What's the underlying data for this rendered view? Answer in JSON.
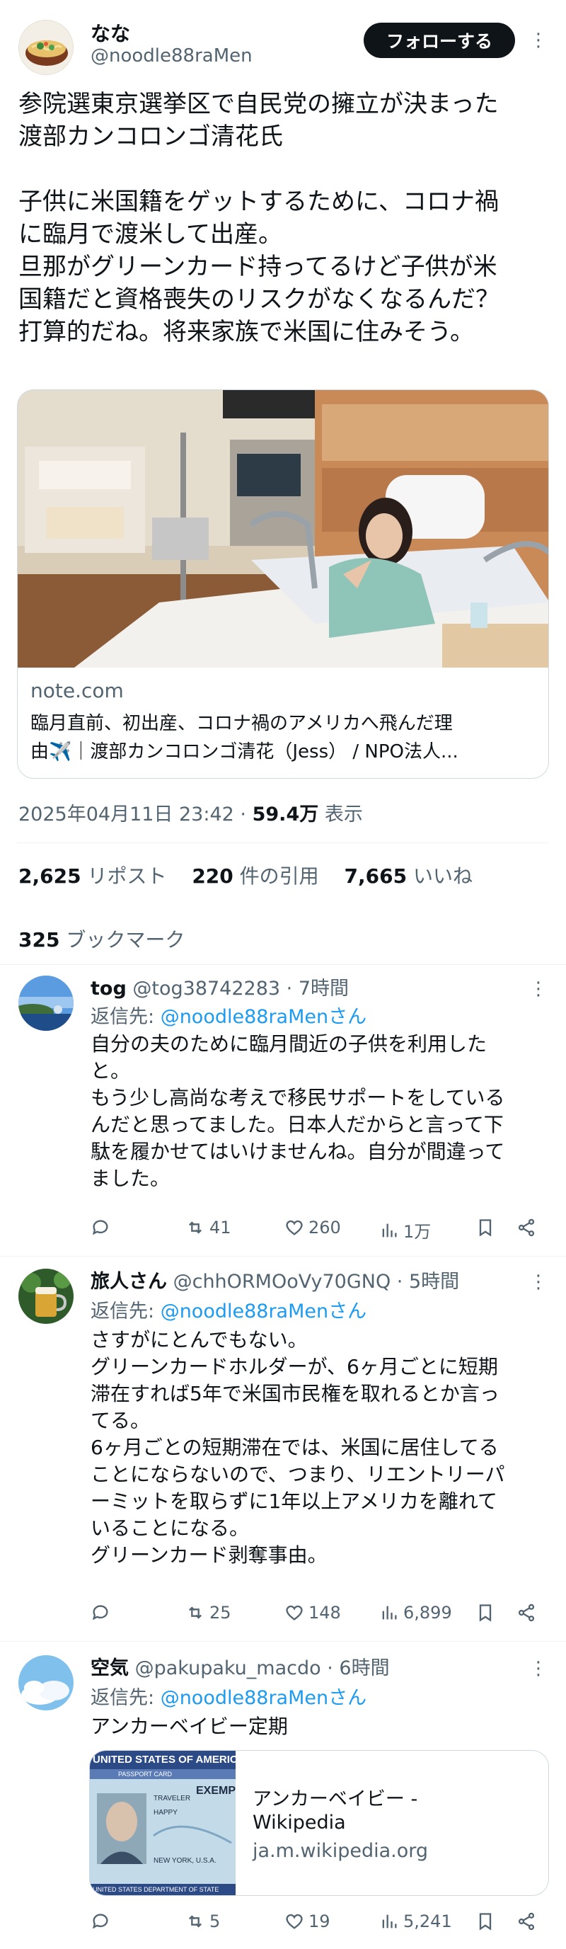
{
  "post": {
    "display_name": "なな",
    "handle": "@noodle88raMen",
    "follow_label": "フォローする",
    "text": "参院選東京選挙区で自民党の擁立が決まった\n渡部カンコロンゴ清花氏\n\n子供に米国籍をゲットするために、コロナ禍\nに臨月で渡米して出産。\n旦那がグリーンカード持ってるけど子供が米\n国籍だと資格喪失のリスクがなくなるんだ？\n打算的だね。将来家族で米国に住みそう。",
    "card": {
      "domain": "note.com",
      "title_line1": "臨月直前、初出産、コロナ禍のアメリカへ飛んだ理",
      "title_line2": "由✈️｜渡部カンコロンゴ清花（Jess） / NPO法人..."
    },
    "timestamp": "2025年04月11日 23:42",
    "dot": "·",
    "views_count": "59.4万",
    "views_label": "表示",
    "reposts_count": "2,625",
    "reposts_label": "リポスト",
    "quotes_count": "220",
    "quotes_label": "件の引用",
    "likes_count": "7,665",
    "likes_label": "いいね",
    "bookmarks_count": "325",
    "bookmarks_label": "ブックマーク"
  },
  "replies": [
    {
      "display_name": "tog",
      "handle": "@tog38742283",
      "time": "· 7時間",
      "reply_to_prefix": "返信先: ",
      "reply_to_handle": "@noodle88raMenさん",
      "text": "自分の夫のために臨月間近の子供を利用した\nと。\nもう少し高尚な考えで移民サポートをしている\nんだと思ってました。日本人だからと言って下\n駄を履かせてはいけませんね。自分が間違って\nました。",
      "reposts": "41",
      "likes": "260",
      "views": "1万"
    },
    {
      "display_name": "旅人さん",
      "handle": "@chhORMOoVy70GNQ",
      "time": "· 5時間",
      "reply_to_prefix": "返信先: ",
      "reply_to_handle": "@noodle88raMenさん",
      "text": "さすがにとんでもない。\nグリーンカードホルダーが、6ヶ月ごとに短期\n滞在すれば5年で米国市民権を取れるとか言っ\nてる。\n6ヶ月ごとの短期滞在では、米国に居住してる\nことにならないので、つまり、リエントリーパ\nーミットを取らずに1年以上アメリカを離れて\nいることになる。\nグリーンカード剥奪事由。",
      "reposts": "25",
      "likes": "148",
      "views": "6,899"
    },
    {
      "display_name": "空気",
      "handle": "@pakupaku_macdo",
      "time": "· 6時間",
      "reply_to_prefix": "返信先: ",
      "reply_to_handle": "@noodle88raMenさん",
      "text": "アンカーベイビー定期",
      "card": {
        "title_line1": "アンカーベイビー -",
        "title_line2": "Wikipedia",
        "domain": "ja.m.wikipedia.org",
        "thumb_text1": "UNITED STATES OF AMERICA",
        "thumb_text2": "PASSPORT CARD",
        "thumb_text3": "TRAVELER",
        "thumb_text4": "HAPPY",
        "thumb_text5": "EXEMP",
        "thumb_text6": "NEW YORK, U.S.A.",
        "thumb_text7": "UNITED STATES DEPARTMENT OF STATE"
      },
      "reposts": "5",
      "likes": "19",
      "views": "5,241"
    }
  ]
}
